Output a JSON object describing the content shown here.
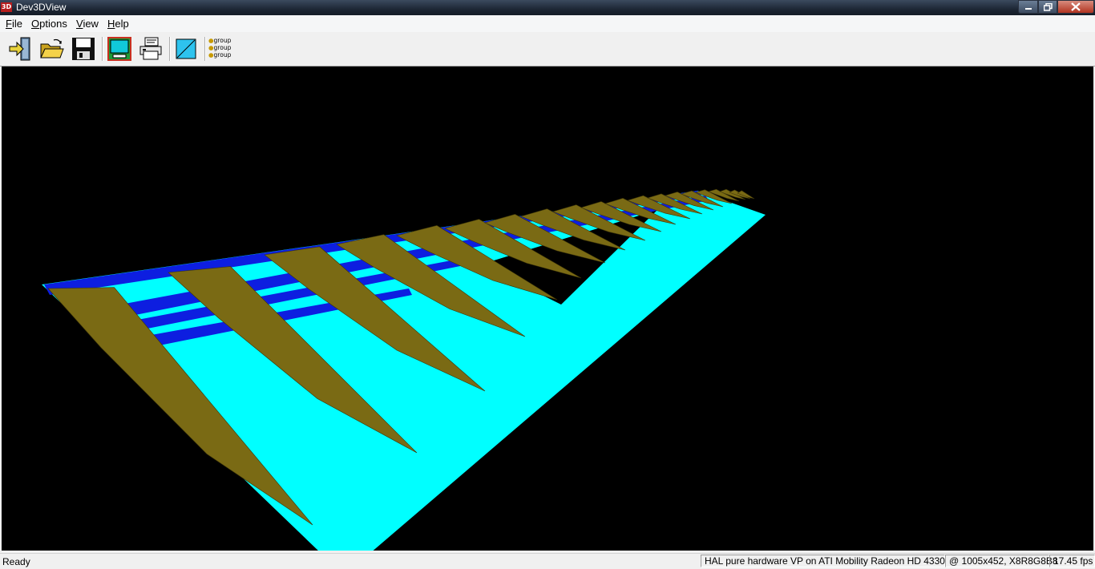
{
  "window": {
    "title": "Dev3DView",
    "icon_label": "3D"
  },
  "menu": {
    "file": {
      "first": "F",
      "rest": "ile"
    },
    "options": {
      "first": "O",
      "rest": "ptions"
    },
    "view": {
      "first": "V",
      "rest": "iew"
    },
    "help": {
      "first": "H",
      "rest": "elp"
    }
  },
  "toolbar": {
    "buttons": [
      {
        "icon": "exit-icon"
      },
      {
        "icon": "open-folder-icon"
      },
      {
        "icon": "save-disk-icon"
      },
      {
        "icon": "screen-capture-icon"
      },
      {
        "icon": "print-icon"
      },
      {
        "icon": "background-color-icon"
      },
      {
        "icon": "group-list-icon"
      }
    ],
    "group_labels": [
      "group",
      "group",
      "group"
    ]
  },
  "scene": {
    "background": "#000000",
    "skin_color": "#00ffff",
    "rib_color": "#7a6a14",
    "spar_color": "#0d1ee0"
  },
  "status": {
    "ready": "Ready",
    "device": "HAL pure hardware VP on ATI Mobility Radeon HD 4330",
    "mode": "@ 1005x452, X8R8G8B8",
    "fps": "17.45 fps"
  }
}
